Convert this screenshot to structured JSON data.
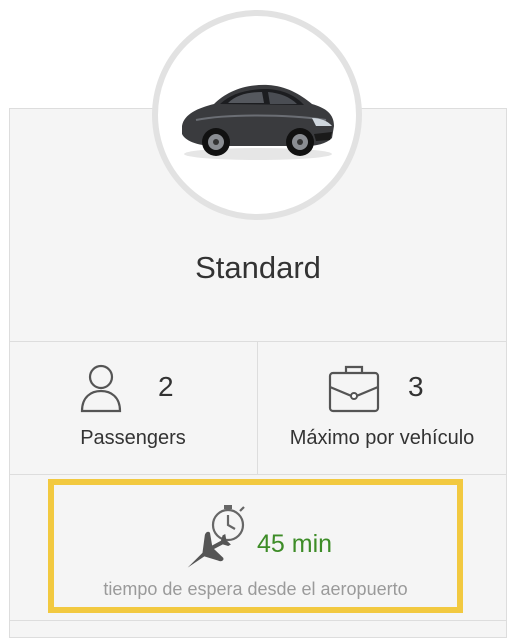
{
  "vehicle": {
    "name": "Standard",
    "image": "car-image"
  },
  "passengers": {
    "count": "2",
    "label": "Passengers",
    "icon": "person-icon"
  },
  "luggage": {
    "count": "3",
    "label": "Máximo por vehículo",
    "icon": "briefcase-icon"
  },
  "wait_time": {
    "value": "45 min",
    "label": "tiempo de espera desde el aeropuerto",
    "icon": "airplane-timer-icon"
  },
  "colors": {
    "highlight_border": "#f2c940",
    "wait_value": "#3d8c27",
    "wait_label": "#9a9a9a",
    "card_background": "#f5f5f5"
  }
}
